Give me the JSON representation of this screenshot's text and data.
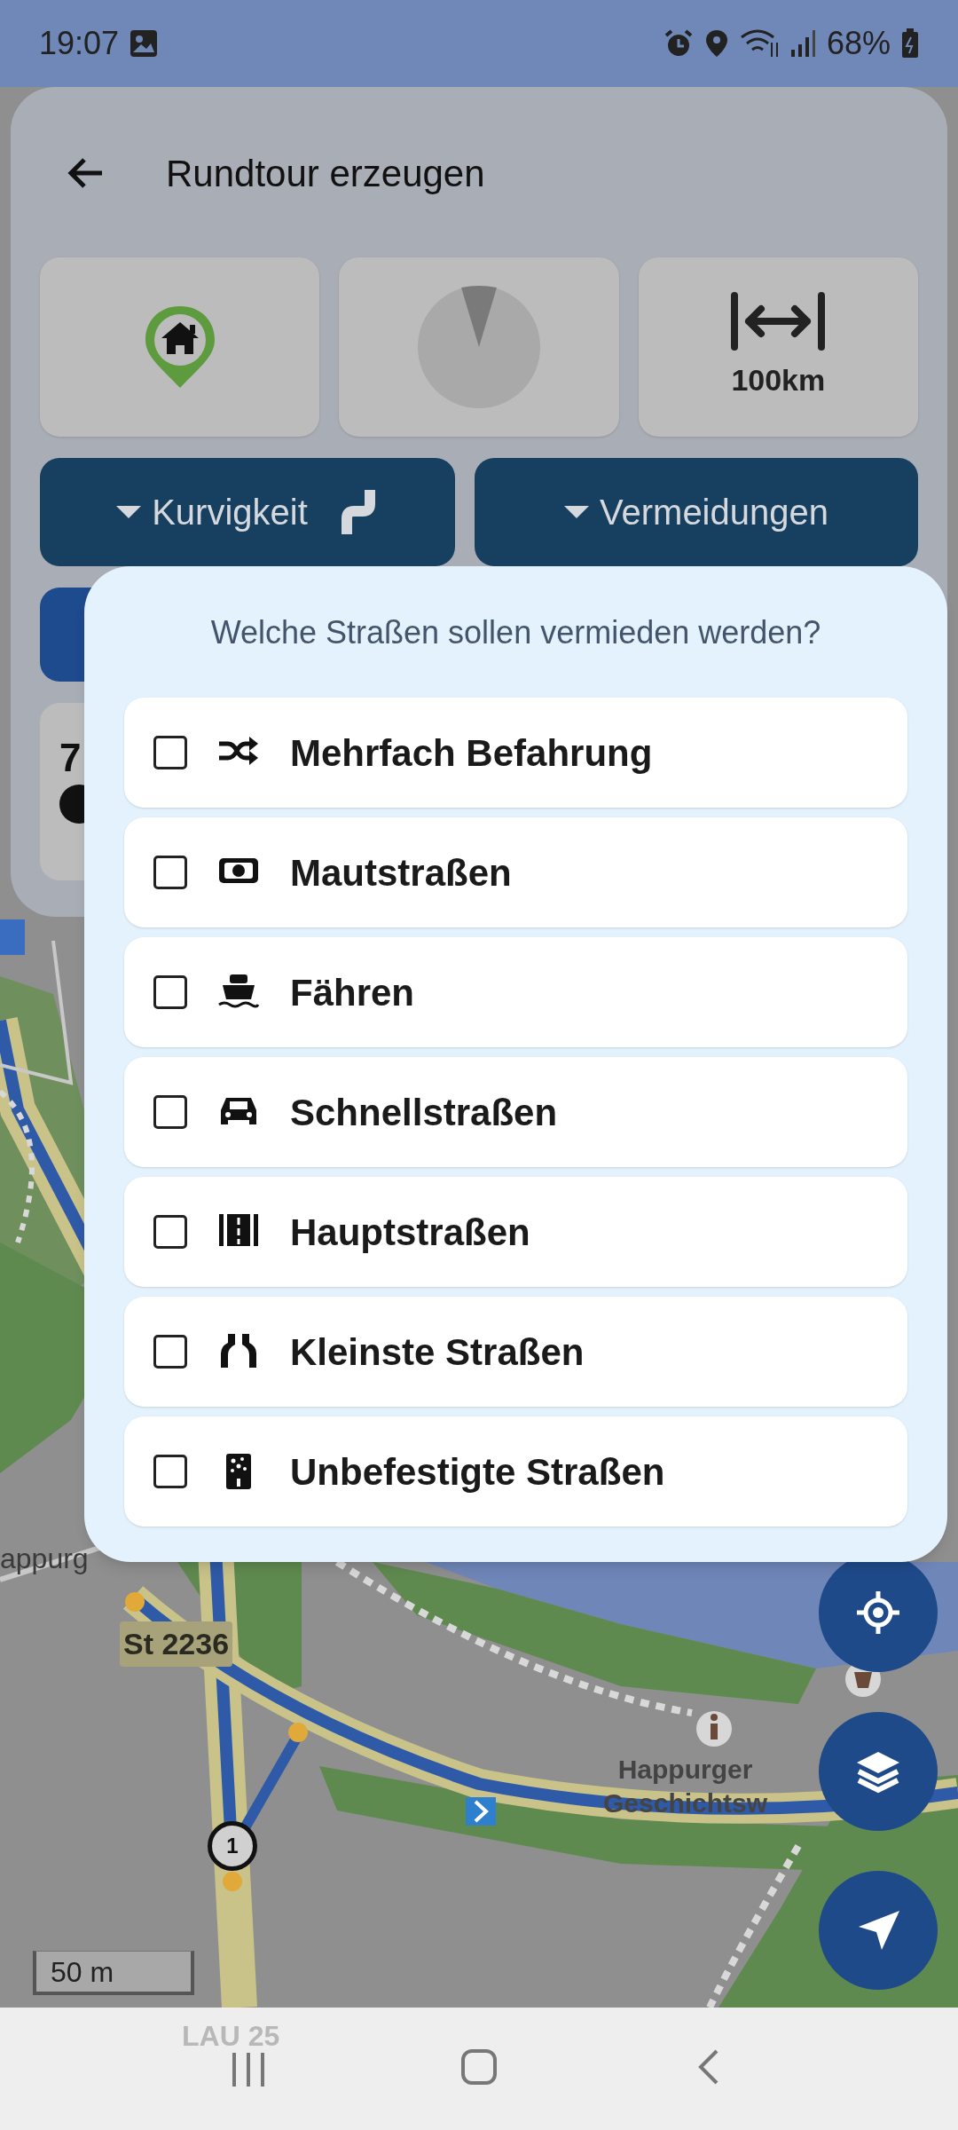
{
  "status_bar": {
    "time": "19:07",
    "battery": "68%"
  },
  "header": {
    "title": "Rundtour erzeugen"
  },
  "tiles": [
    {
      "kind": "start"
    },
    {
      "kind": "direction"
    },
    {
      "kind": "distance",
      "label": "100km"
    }
  ],
  "dropdowns": [
    {
      "label": "Kurvigkeit",
      "kind": "curvy"
    },
    {
      "label": "Vermeidungen",
      "kind": "plain"
    }
  ],
  "summary_card": {
    "value": "7"
  },
  "dialog": {
    "title": "Welche Straßen sollen vermieden werden?",
    "options": [
      {
        "label": "Mehrfach Befahrung",
        "kind": "shuffle",
        "checked": false
      },
      {
        "label": "Mautstraßen",
        "kind": "money",
        "checked": false
      },
      {
        "label": "Fähren",
        "kind": "ferry",
        "checked": false
      },
      {
        "label": "Schnellstraßen",
        "kind": "car",
        "checked": false
      },
      {
        "label": "Hauptstraßen",
        "kind": "road",
        "checked": false
      },
      {
        "label": "Kleinste Straßen",
        "kind": "narrow",
        "checked": false
      },
      {
        "label": "Unbefestigte Straßen",
        "kind": "gravel",
        "checked": false
      }
    ]
  },
  "map": {
    "place_label": "appurg",
    "road_label": "St 2236",
    "poi_label": [
      "Happurger",
      "Geschichtsw"
    ],
    "faded_label": "LAU 25",
    "route_marker": "1",
    "scale": "50 m"
  }
}
